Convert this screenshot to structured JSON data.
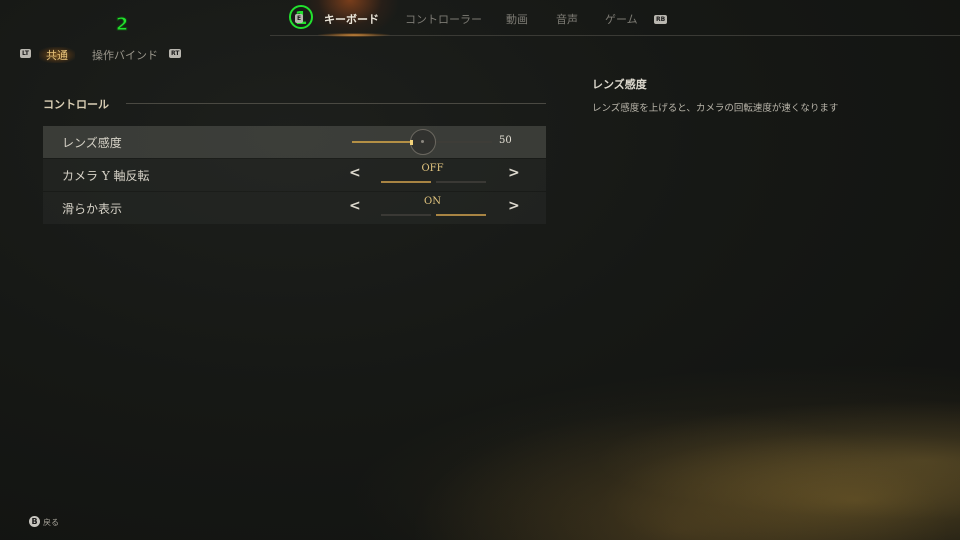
{
  "header": {
    "left_hint": "E",
    "right_hint": "RB",
    "tabs": [
      {
        "label": "キーボード",
        "active": true
      },
      {
        "label": "コントローラー",
        "active": false
      },
      {
        "label": "動画",
        "active": false
      },
      {
        "label": "音声",
        "active": false
      },
      {
        "label": "ゲーム",
        "active": false
      }
    ]
  },
  "annotations": {
    "one": "1",
    "two": "2"
  },
  "subtabs": {
    "left_hint": "LT",
    "right_hint": "RT",
    "items": [
      {
        "label": "共通",
        "active": true
      },
      {
        "label": "操作バインド",
        "active": false
      }
    ]
  },
  "section": {
    "title": "コントロール",
    "rows": [
      {
        "label": "レンズ感度",
        "type": "slider",
        "value": "50",
        "fraction": 0.5
      },
      {
        "label": "カメラ Y 軸反転",
        "type": "toggle",
        "value": "OFF",
        "prev": "<",
        "next": ">"
      },
      {
        "label": "滑らか表示",
        "type": "toggle",
        "value": "ON",
        "prev": "<",
        "next": ">"
      }
    ]
  },
  "description": {
    "title": "レンズ感度",
    "text": "レンズ感度を上げると、カメラの回転速度が速くなります"
  },
  "footer": {
    "button": "B",
    "label": "戻る"
  },
  "colors": {
    "accent": "#e0c37e",
    "slider_fill": "#b49045",
    "annotation": "#22e22e"
  }
}
